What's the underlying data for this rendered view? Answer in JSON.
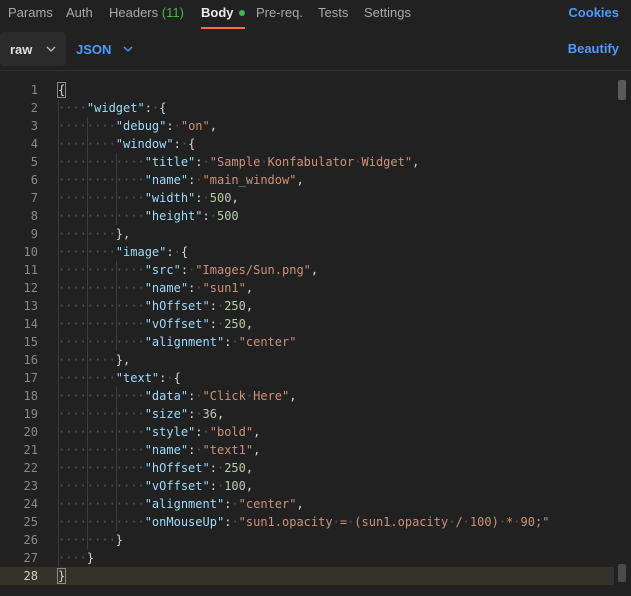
{
  "tabs": {
    "params": "Params",
    "auth": "Auth",
    "headers": "Headers",
    "headers_count": "(11)",
    "body": "Body",
    "prereq": "Pre-req.",
    "tests": "Tests",
    "settings": "Settings",
    "cookies": "Cookies"
  },
  "toolbar": {
    "body_type": "raw",
    "format": "JSON",
    "beautify": "Beautify"
  },
  "editor": {
    "current_line": 28,
    "lines": [
      "{",
      "    \"widget\": {",
      "        \"debug\": \"on\",",
      "        \"window\": {",
      "            \"title\": \"Sample Konfabulator Widget\",",
      "            \"name\": \"main_window\",",
      "            \"width\": 500,",
      "            \"height\": 500",
      "        },",
      "        \"image\": {",
      "            \"src\": \"Images/Sun.png\",",
      "            \"name\": \"sun1\",",
      "            \"hOffset\": 250,",
      "            \"vOffset\": 250,",
      "            \"alignment\": \"center\"",
      "        },",
      "        \"text\": {",
      "            \"data\": \"Click Here\",",
      "            \"size\": 36,",
      "            \"style\": \"bold\",",
      "            \"name\": \"text1\",",
      "            \"hOffset\": 250,",
      "            \"vOffset\": 100,",
      "            \"alignment\": \"center\",",
      "            \"onMouseUp\": \"sun1.opacity = (sun1.opacity / 100) * 90;\"",
      "        }",
      "    }",
      "}"
    ]
  },
  "colors": {
    "accent_orange": "#ff6c37",
    "link_blue": "#4c9bff",
    "count_green": "#3fb950",
    "key": "#9cdcfe",
    "string": "#ce9178",
    "number": "#b5cea8"
  }
}
